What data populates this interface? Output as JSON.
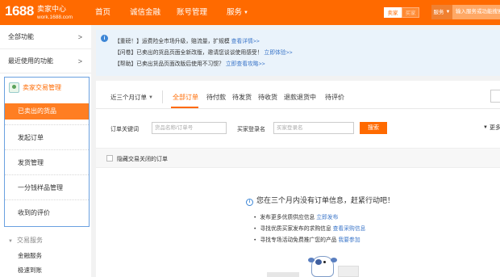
{
  "header": {
    "logo_number": "1688",
    "logo_title": "卖家中心",
    "logo_url": "work.1688.com",
    "nav": [
      "首页",
      "诚信金融",
      "账号管理",
      "服务"
    ],
    "role_seller": "卖家",
    "role_buyer": "买家",
    "search_type": "服务",
    "search_placeholder": "输入服务或功能搜索"
  },
  "sidebar": {
    "all_functions": "全部功能",
    "recent_functions": "最近使用的功能",
    "group_title": "卖家交易管理",
    "group_items": [
      "已卖出的货品",
      "发起订单",
      "发货管理",
      "一分钱样品管理",
      "收到的评价"
    ],
    "section_title": "交易服务",
    "section_links": [
      "金融服务",
      "极速到账"
    ]
  },
  "notice": {
    "lines": [
      {
        "text": "【重磅！】运费险全市场升级，赔流量，扩规模",
        "link": "查看详情>>"
      },
      {
        "text": "【问卷】已卖出的货品页面全新改版，邀请您谈谈使用感受！",
        "link": "立即体验>>"
      },
      {
        "text": "【帮助】已卖出货品页面改版后使用不习惯？",
        "link": "立即查看攻略>>"
      }
    ]
  },
  "orders": {
    "period": "近三个月订单",
    "tabs": [
      "全部订单",
      "待付款",
      "待发货",
      "待收货",
      "退款退货中",
      "待评价"
    ],
    "active_tab": "全部订单"
  },
  "filter": {
    "keyword_label": "订单关键词",
    "keyword_placeholder": "货品名称/订单号",
    "buyer_label": "买家登录名",
    "buyer_placeholder": "买家登录名",
    "search_button": "搜索",
    "more": "更多"
  },
  "hide_closed_label": "隐藏交易关闭的订单",
  "empty": {
    "title": "您在三个月内没有订单信息，赶紧行动吧！",
    "tips": [
      {
        "text": "发布更多优质供应信息",
        "link": "立即发布"
      },
      {
        "text": "寻找优质买家发布的求购信息",
        "link": "查看采购信息"
      },
      {
        "text": "寻找专场活动免费推广您的产品",
        "link": "我要参加"
      }
    ]
  },
  "colors": {
    "brand": "#ff6a00",
    "link": "#3d77c9",
    "notice_bg": "#eaf3fb"
  }
}
